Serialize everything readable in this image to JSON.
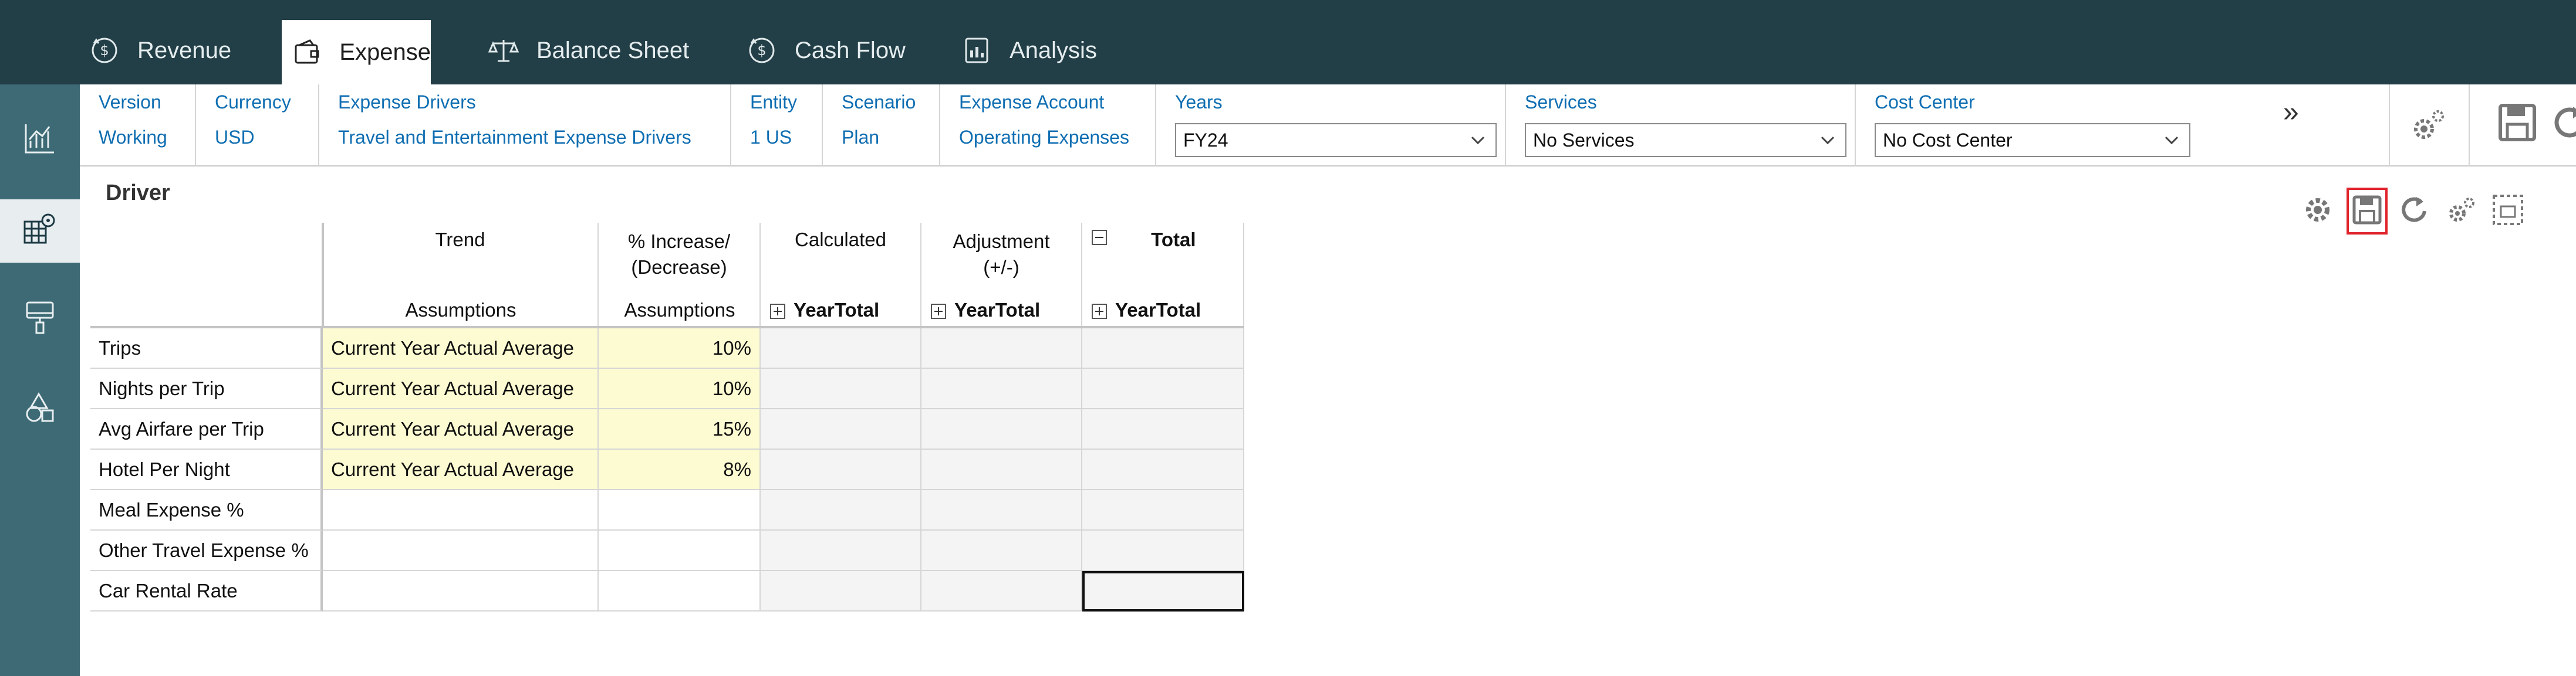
{
  "nav": {
    "tabs": [
      {
        "label": "Revenue",
        "icon": "dollar-cycle-icon"
      },
      {
        "label": "Expense",
        "icon": "wallet-icon"
      },
      {
        "label": "Balance Sheet",
        "icon": "scales-icon"
      },
      {
        "label": "Cash Flow",
        "icon": "dollar-cycle-icon"
      },
      {
        "label": "Analysis",
        "icon": "report-icon"
      }
    ],
    "active_tab": "Expense"
  },
  "rail": {
    "items": [
      "chart-icon",
      "grid-settings-icon",
      "paint-roller-icon",
      "shapes-icon"
    ],
    "active_index": 1
  },
  "pov": {
    "version": {
      "label": "Version",
      "value": "Working"
    },
    "currency": {
      "label": "Currency",
      "value": "USD"
    },
    "drivers": {
      "label": "Expense Drivers",
      "value": "Travel and Entertainment Expense Drivers"
    },
    "entity": {
      "label": "Entity",
      "value": "1 US"
    },
    "scenario": {
      "label": "Scenario",
      "value": "Plan"
    },
    "account": {
      "label": "Expense Account",
      "value": "Operating Expenses"
    },
    "years": {
      "label": "Years",
      "value": "FY24"
    },
    "services": {
      "label": "Services",
      "value": "No Services"
    },
    "cost_center": {
      "label": "Cost Center",
      "value": "No Cost Center"
    },
    "more": "»"
  },
  "panel": {
    "title": "Driver"
  },
  "grid": {
    "headers": {
      "trend_top": "Trend",
      "trend_bottom": "Assumptions",
      "increase_top": "% Increase/ (Decrease)",
      "increase_bottom": "Assumptions",
      "calc_top": "Calculated",
      "calc_bottom": "YearTotal",
      "adj_top": "Adjustment (+/-)",
      "adj_bottom": "YearTotal",
      "total_top": "Total",
      "total_bottom": "YearTotal"
    },
    "rows": [
      {
        "label": "Trips",
        "trend": "Current Year Actual Average",
        "pct": "10%"
      },
      {
        "label": "Nights per Trip",
        "trend": "Current Year Actual Average",
        "pct": "10%"
      },
      {
        "label": "Avg Airfare per Trip",
        "trend": "Current Year Actual Average",
        "pct": "15%"
      },
      {
        "label": "Hotel Per Night",
        "trend": "Current Year Actual Average",
        "pct": "8%"
      },
      {
        "label": "Meal Expense %",
        "trend": "",
        "pct": ""
      },
      {
        "label": "Other Travel Expense %",
        "trend": "",
        "pct": ""
      },
      {
        "label": "Car Rental Rate",
        "trend": "",
        "pct": ""
      }
    ]
  },
  "colors": {
    "nav_bg": "#223e46",
    "rail_bg": "#3d6a75",
    "link_blue": "#0f6eb2",
    "input_yellow": "#fdfbd2",
    "highlight_red": "#e0242c"
  }
}
